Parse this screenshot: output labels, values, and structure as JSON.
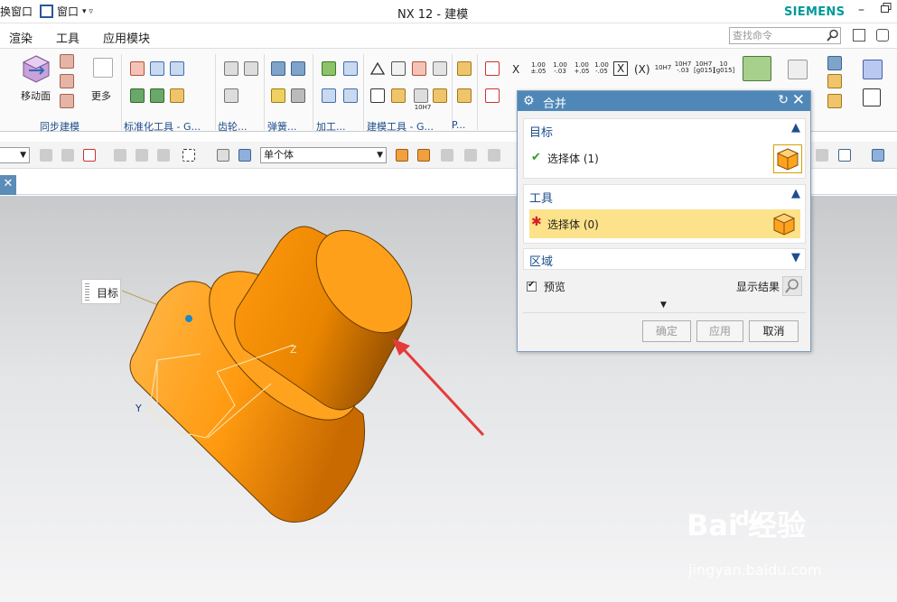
{
  "titlebar": {
    "left_fragment": "换窗口",
    "window_menu": "窗口",
    "window_menu_caret": "▾ ▿",
    "app_title": "NX 12 - 建模",
    "brand": "SIEMENS",
    "min_icon": "–",
    "restore_icon": "🗗"
  },
  "menubar": {
    "items": [
      "渲染",
      "工具",
      "应用模块"
    ],
    "search_placeholder": "查找命令"
  },
  "ribbon": {
    "move_face_label": "移动面",
    "more_label": "更多",
    "groups": [
      "同步建模",
      "标准化工具 - G...",
      "齿轮...",
      "弹簧...",
      "加工...",
      "建模工具 - G...",
      "P..."
    ],
    "pmi_symbols": {
      "x": "X",
      "t1": "1.00\n±.05",
      "t2": "1.00\n-.03",
      "t3": "1.00\n+.05",
      "t4": "1.00\n-.05",
      "box_x": "X",
      "paren_x": "(X)",
      "h7a": "10H7",
      "h7b": "10H7\n-.03",
      "h7c": "10H7\n[g015]",
      "h7d": "10\n[g015]",
      "h7e": "10H7"
    }
  },
  "selection_bar": {
    "filter_value": "单个体"
  },
  "viewport": {
    "target_tag": "目标",
    "axis_y": "Y",
    "axis_z": "Z",
    "watermark_main": "Bai 经验",
    "watermark_paw": "du",
    "watermark_url": "jingyan.baidu.com"
  },
  "dialog": {
    "title": "合并",
    "target_section": "目标",
    "target_select": "选择体 (1)",
    "tool_section": "工具",
    "tool_select": "选择体 (0)",
    "region_section": "区域",
    "preview_label": "预览",
    "show_result_label": "显示结果",
    "ok_label": "确定",
    "apply_label": "应用",
    "cancel_label": "取消"
  },
  "colors": {
    "accent_blue": "#4f88b8",
    "highlight_yellow": "#fce28a",
    "body_orange": "#ff9900",
    "arrow_red": "#e53a3a"
  }
}
